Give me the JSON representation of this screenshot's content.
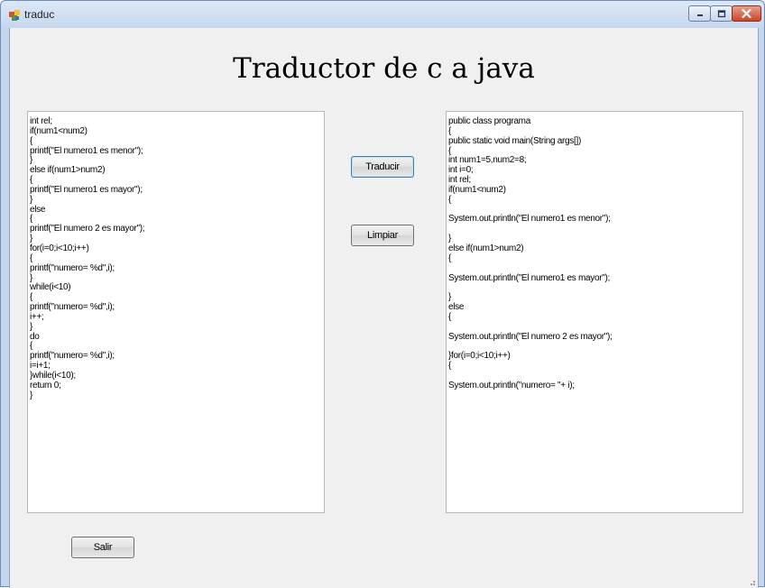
{
  "window": {
    "title": "traduc",
    "icon": "windows-form-icon",
    "controls": [
      "minimize",
      "maximize",
      "close"
    ]
  },
  "main": {
    "heading": "Traductor de c a java",
    "input_code": "int rel;\nif(num1<num2)\n{\nprintf(\"El numero1 es menor\");\n}\nelse if(num1>num2)\n{\nprintf(\"El numero1 es mayor\");\n}\nelse\n{\nprintf(\"El numero 2 es mayor\");\n}\nfor(i=0;i<10;i++)\n{\nprintf(\"numero= %d\",i);\n}\nwhile(i<10)\n{\nprintf(\"numero= %d\",i);\ni++;\n}\ndo\n{\nprintf(\"numero= %d\",i);\ni=i+1;\n}while(i<10);\nreturn 0;\n}",
    "output_code": "public class programa\n{\npublic static void main(String args[])\n{\nint num1=5,num2=8;\nint i=0;\nint rel;\nif(num1<num2)\n{\n\nSystem.out.println(\"El numero1 es menor\");\n\n}\nelse if(num1>num2)\n{\n\nSystem.out.println(\"El numero1 es mayor\");\n\n}\nelse\n{\n\nSystem.out.println(\"El numero 2 es mayor\");\n\n}for(i=0;i<10;i++)\n{\n\nSystem.out.println(\"numero= \"+ i);",
    "buttons": {
      "translate_label": "Traducir",
      "clear_label": "Limpiar",
      "exit_label": "Salir"
    }
  },
  "colors": {
    "window_frame": "#c4d6ec",
    "client_background": "#f0f0f0",
    "close_button": "#c9452a"
  }
}
